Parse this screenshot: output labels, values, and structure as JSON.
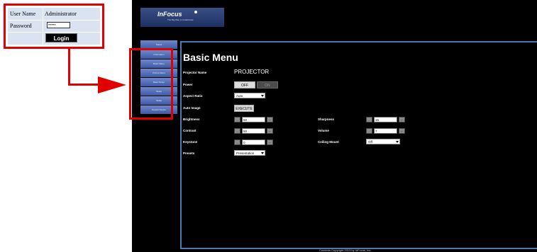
{
  "login": {
    "username_label": "User Name",
    "username_value": "Administrator",
    "password_label": "Password",
    "password_value": "•••••",
    "login_button": "Login"
  },
  "logo": {
    "brand": "InFocus",
    "tagline": "The Big Way to Collaborate"
  },
  "sidebar": {
    "items": [
      {
        "label": "Status"
      },
      {
        "label": "Information"
      },
      {
        "label": "Basic Menu"
      },
      {
        "label": "Picture Menu"
      },
      {
        "label": "Basic Setup"
      },
      {
        "label": "Setup"
      },
      {
        "label": "Setup"
      },
      {
        "label": "Restart Device"
      }
    ]
  },
  "page": {
    "title": "Basic Menu",
    "projector_name_label": "Projector Name",
    "projector_name_value": "PROJECTOR",
    "power_label": "Power",
    "power_off": "OFF",
    "power_on": "ON",
    "aspect_ratio_label": "Aspect Ratio",
    "aspect_ratio_value": "Auto",
    "auto_image_label": "Auto Image",
    "auto_image_button": "EXECUTE",
    "brightness_label": "Brightness",
    "brightness_value": "50",
    "contrast_label": "Contrast",
    "contrast_value": "50",
    "keystone_label": "Keystone",
    "keystone_value": "0",
    "presets_label": "Presets",
    "presets_value": "Presentation",
    "sharpness_label": "Sharpness",
    "sharpness_value": "16",
    "volume_label": "Volume",
    "volume_value": "7",
    "ceiling_mount_label": "Ceiling Mount",
    "ceiling_mount_value": "Off",
    "stepper_minus": "-",
    "stepper_plus": "+"
  },
  "footer": {
    "copyright": "Contents Copyright 2013 by InFocus, Inc."
  },
  "colors": {
    "highlight": "#e00000",
    "frame_border": "#4b79b5",
    "sidebar_button": "#5a74bb"
  }
}
